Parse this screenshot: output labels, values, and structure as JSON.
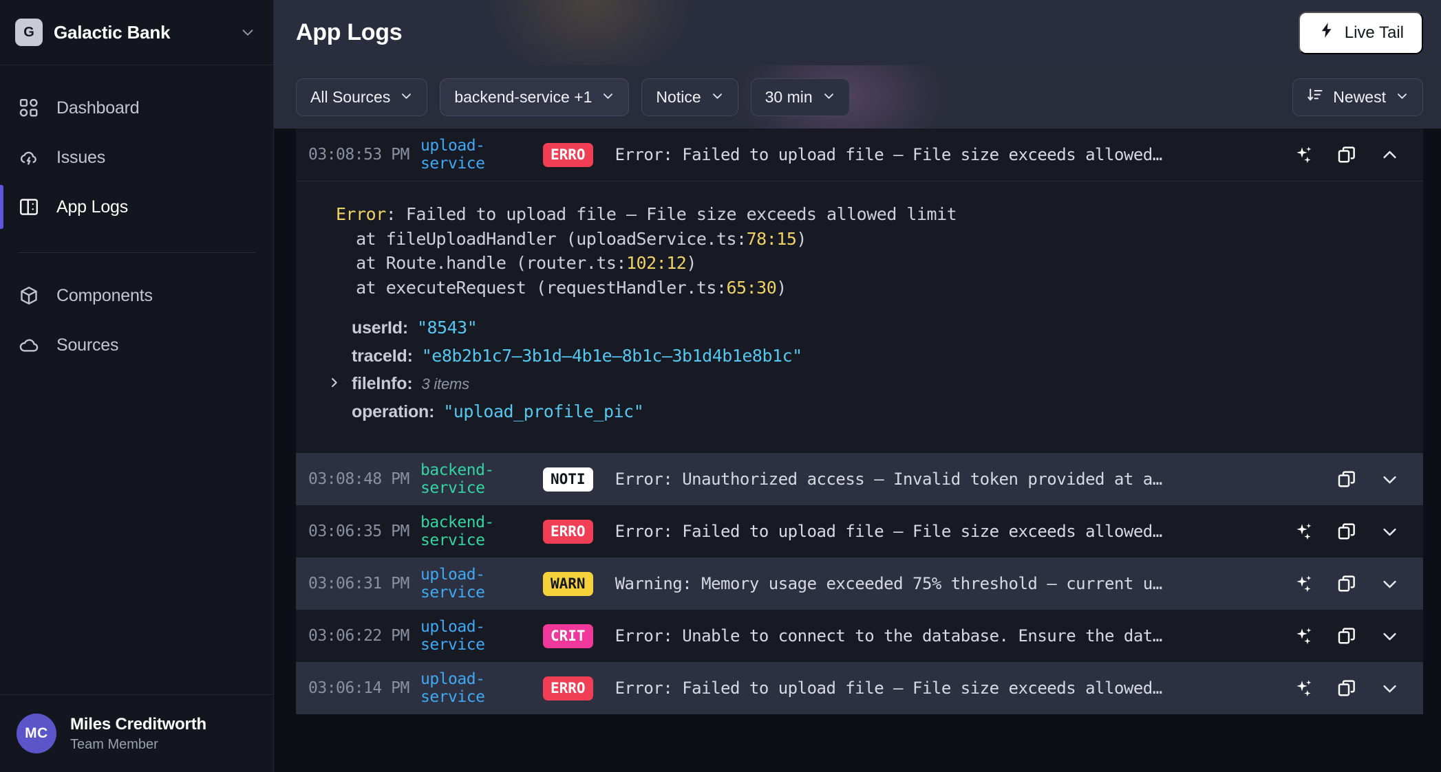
{
  "sidebar": {
    "org": {
      "initial": "G",
      "name": "Galactic Bank",
      "chevron_icon": "chevron-down-icon"
    },
    "items": [
      {
        "label": "Dashboard",
        "icon": "dashboard-grid-icon",
        "active": false
      },
      {
        "label": "Issues",
        "icon": "cloud-bolt-icon",
        "active": false
      },
      {
        "label": "App Logs",
        "icon": "panels-icon",
        "active": true
      },
      {
        "label": "Components",
        "icon": "cube-icon",
        "active": false
      },
      {
        "label": "Sources",
        "icon": "cloud-icon",
        "active": false
      }
    ],
    "user": {
      "initials": "MC",
      "name": "Miles Creditworth",
      "role": "Team Member"
    }
  },
  "header": {
    "title": "App Logs",
    "live_tail_label": "Live Tail",
    "live_tail_icon": "lightning-bolt-icon"
  },
  "filters": [
    {
      "label": "All Sources",
      "accent": false,
      "icon": "chevron-down-icon"
    },
    {
      "label": "backend-service +1",
      "accent": true,
      "icon": "chevron-down-icon"
    },
    {
      "label": "Notice",
      "accent": false,
      "icon": "chevron-down-icon"
    },
    {
      "label": "30 min",
      "accent": false,
      "icon": "chevron-down-icon"
    }
  ],
  "sort": {
    "label": "Newest",
    "lead_icon": "sort-descending-icon",
    "icon": "chevron-down-icon"
  },
  "colors": {
    "accent_purple": "#5b55e0",
    "error_red": "#f03e55",
    "warn_yellow": "#f5d13b",
    "crit_pink": "#f0389b",
    "notice_white": "#ffffff",
    "source_blue": "#3fa9f5",
    "source_green": "#32d6a0"
  },
  "logs": [
    {
      "time": "03:08:53 PM",
      "source": "upload-service",
      "source_color": "blue",
      "level": "ERRO",
      "level_class": "b-erro",
      "message": "Error: Failed to upload file – File size exceeds allowed…",
      "has_ai": true,
      "expanded": true,
      "toggle_icon": "chevron-up-icon",
      "detail": {
        "stack_lines": [
          {
            "prefix": "",
            "head": "Error",
            "rest": ": Failed to upload file – File size exceeds allowed limit",
            "loc": ""
          },
          {
            "prefix": "  at fileUploadHandler (uploadService.ts:",
            "head": "",
            "rest": ")",
            "loc": "78:15"
          },
          {
            "prefix": "  at Route.handle (router.ts:",
            "head": "",
            "rest": ")",
            "loc": "102:12"
          },
          {
            "prefix": "  at executeRequest (requestHandler.ts:",
            "head": "",
            "rest": ")",
            "loc": "65:30"
          }
        ],
        "fields": [
          {
            "key": "userId:",
            "value": "\"8543\"",
            "expandable": false,
            "count": ""
          },
          {
            "key": "traceId:",
            "value": "\"e8b2b1c7–3b1d–4b1e–8b1c–3b1d4b1e8b1c\"",
            "expandable": false,
            "count": ""
          },
          {
            "key": "fileInfo:",
            "value": "",
            "expandable": true,
            "count": "3 items",
            "toggle_icon": "chevron-right-icon"
          },
          {
            "key": "operation:",
            "value": "\"upload_profile_pic\"",
            "expandable": false,
            "count": ""
          }
        ]
      }
    },
    {
      "time": "03:08:48 PM",
      "source": "backend-service",
      "source_color": "green",
      "level": "NOTI",
      "level_class": "b-noti",
      "message": "Error: Unauthorized access – Invalid token provided at a…",
      "has_ai": false,
      "expanded": false,
      "toggle_icon": "chevron-down-icon"
    },
    {
      "time": "03:06:35 PM",
      "source": "backend-service",
      "source_color": "green",
      "level": "ERRO",
      "level_class": "b-erro",
      "message": "Error: Failed to upload file – File size exceeds allowed…",
      "has_ai": true,
      "expanded": false,
      "toggle_icon": "chevron-down-icon"
    },
    {
      "time": "03:06:31 PM",
      "source": "upload-service",
      "source_color": "blue",
      "level": "WARN",
      "level_class": "b-warn",
      "message": "Warning: Memory usage exceeded 75% threshold – current u…",
      "has_ai": true,
      "expanded": false,
      "toggle_icon": "chevron-down-icon"
    },
    {
      "time": "03:06:22 PM",
      "source": "upload-service",
      "source_color": "blue",
      "level": "CRIT",
      "level_class": "b-crit",
      "message": "Error: Unable to connect to the database. Ensure the dat…",
      "has_ai": true,
      "expanded": false,
      "toggle_icon": "chevron-down-icon"
    },
    {
      "time": "03:06:14 PM",
      "source": "upload-service",
      "source_color": "blue",
      "level": "ERRO",
      "level_class": "b-erro",
      "message": "Error: Failed to upload file – File size exceeds allowed…",
      "has_ai": true,
      "expanded": false,
      "toggle_icon": "chevron-down-icon"
    }
  ]
}
